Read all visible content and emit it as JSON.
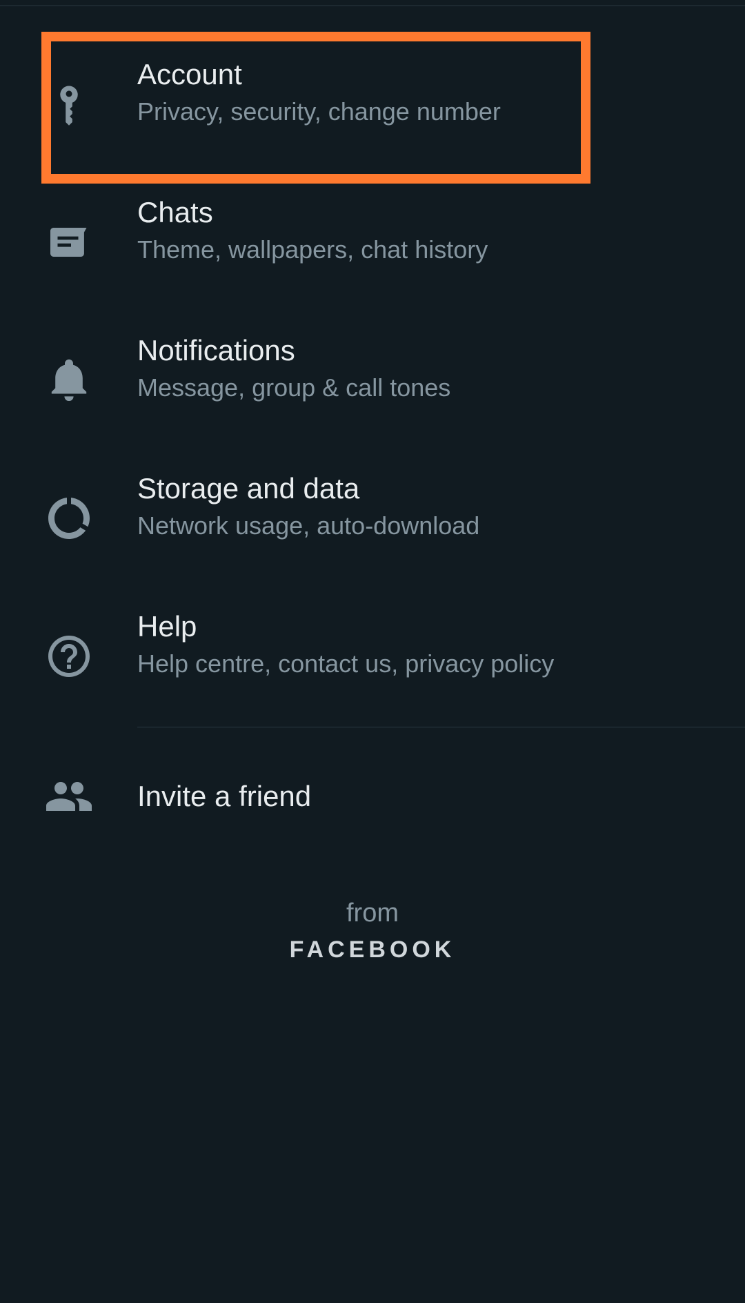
{
  "settings": {
    "items": [
      {
        "id": "account",
        "icon": "key-icon",
        "title": "Account",
        "subtitle": "Privacy, security, change number"
      },
      {
        "id": "chats",
        "icon": "chat-icon",
        "title": "Chats",
        "subtitle": "Theme, wallpapers, chat history"
      },
      {
        "id": "notifications",
        "icon": "bell-icon",
        "title": "Notifications",
        "subtitle": "Message, group & call tones"
      },
      {
        "id": "storage",
        "icon": "data-usage-icon",
        "title": "Storage and data",
        "subtitle": "Network usage, auto-download"
      },
      {
        "id": "help",
        "icon": "help-icon",
        "title": "Help",
        "subtitle": "Help centre, contact us, privacy policy"
      }
    ],
    "invite": {
      "icon": "people-icon",
      "title": "Invite a friend"
    }
  },
  "footer": {
    "from": "from",
    "brand": "FACEBOOK"
  },
  "colors": {
    "background": "#111b21",
    "primary_text": "#e9edef",
    "secondary_text": "#8696a0",
    "divider": "#2a3942",
    "highlight": "#ff7a2f"
  }
}
